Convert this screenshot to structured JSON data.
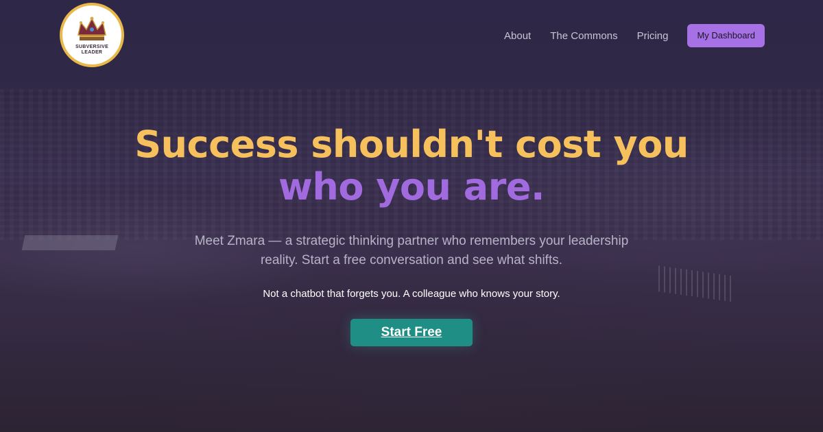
{
  "brand": {
    "logo_text": "SUBVERSIVE LEADER",
    "logo_icon": "crown-icon",
    "accent_gold": "#e8b94a"
  },
  "nav": {
    "items": [
      {
        "label": "About"
      },
      {
        "label": "The Commons"
      },
      {
        "label": "Pricing"
      }
    ],
    "dashboard_label": "My Dashboard"
  },
  "hero": {
    "headline_line1": "Success shouldn't cost you",
    "headline_line2": "who you are.",
    "subheadline": "Meet Zmara — a strategic thinking partner who remembers your leadership reality. Start a free conversation and see what shifts.",
    "tagline": "Not a chatbot that forgets you. A colleague who knows your story.",
    "cta_label": "Start Free"
  },
  "colors": {
    "headline_gold": "#f6c15d",
    "headline_purple": "#a16adf",
    "button_purple": "#a671e4",
    "cta_teal": "#1f8f86"
  }
}
